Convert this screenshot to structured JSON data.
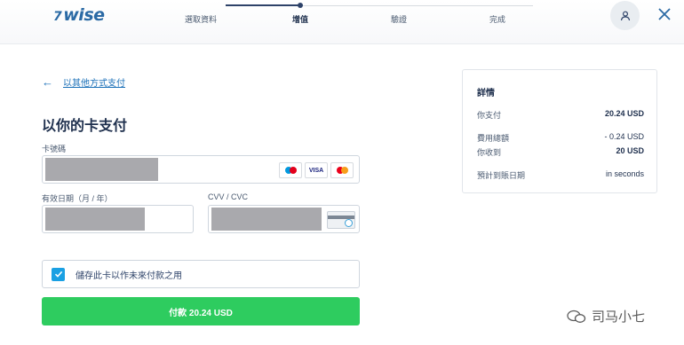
{
  "header": {
    "logo": "wise",
    "steps": [
      "選取資料",
      "增值",
      "驗證",
      "完成"
    ],
    "active_step_index": 1
  },
  "main": {
    "back_link": "以其他方式支付",
    "title": "以你的卡支付",
    "card_number_label": "卡號碼",
    "expiry_label": "有效日期（月 / 年）",
    "cvv_label": "CVV / CVC",
    "card_brands": [
      "maestro-logo",
      "VISA",
      "mastercard-logo"
    ],
    "save_card_label": "儲存此卡以作未來付款之用",
    "save_card_checked": true,
    "pay_button": "付款 20.24 USD"
  },
  "details": {
    "title": "詳情",
    "rows": [
      {
        "label": "你支付",
        "value": "20.24 USD"
      },
      {
        "label": "費用總額",
        "value": "- 0.24 USD"
      },
      {
        "label": "你收到",
        "value": "20 USD"
      },
      {
        "label": "預計到賬日期",
        "value": "in seconds"
      }
    ]
  },
  "watermark": "司马小七",
  "colors": {
    "brand": "#2b6aa5",
    "pay_button": "#2ecc5f",
    "checkbox": "#1aa0e3",
    "link": "#1b70b8"
  }
}
